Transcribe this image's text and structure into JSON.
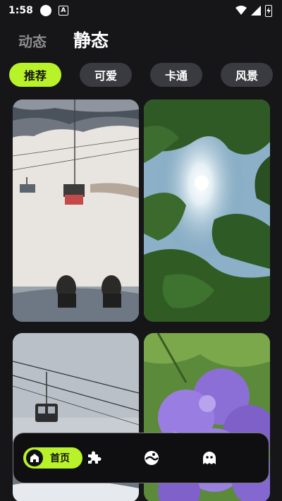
{
  "status_bar": {
    "time": "1:58",
    "notification_letter": "A"
  },
  "top_tabs": {
    "dynamic_label": "动态",
    "static_label": "静态"
  },
  "categories": [
    {
      "label": "推荐",
      "active": true
    },
    {
      "label": "可爱",
      "active": false
    },
    {
      "label": "卡通",
      "active": false
    },
    {
      "label": "风景",
      "active": false
    }
  ],
  "wallpapers": [
    {
      "subject": "ski lift over snowy slope"
    },
    {
      "subject": "sunlight through tree leaves"
    },
    {
      "subject": "cable car in snowy mountains"
    },
    {
      "subject": "purple jacaranda flowers"
    }
  ],
  "bottom_nav": {
    "home_label": "首页",
    "items": [
      "home-icon",
      "puzzle-icon",
      "palette-icon",
      "ghost-icon"
    ]
  },
  "colors": {
    "accent": "#b8f32a",
    "background": "#161618",
    "chip": "#3a3b40"
  }
}
